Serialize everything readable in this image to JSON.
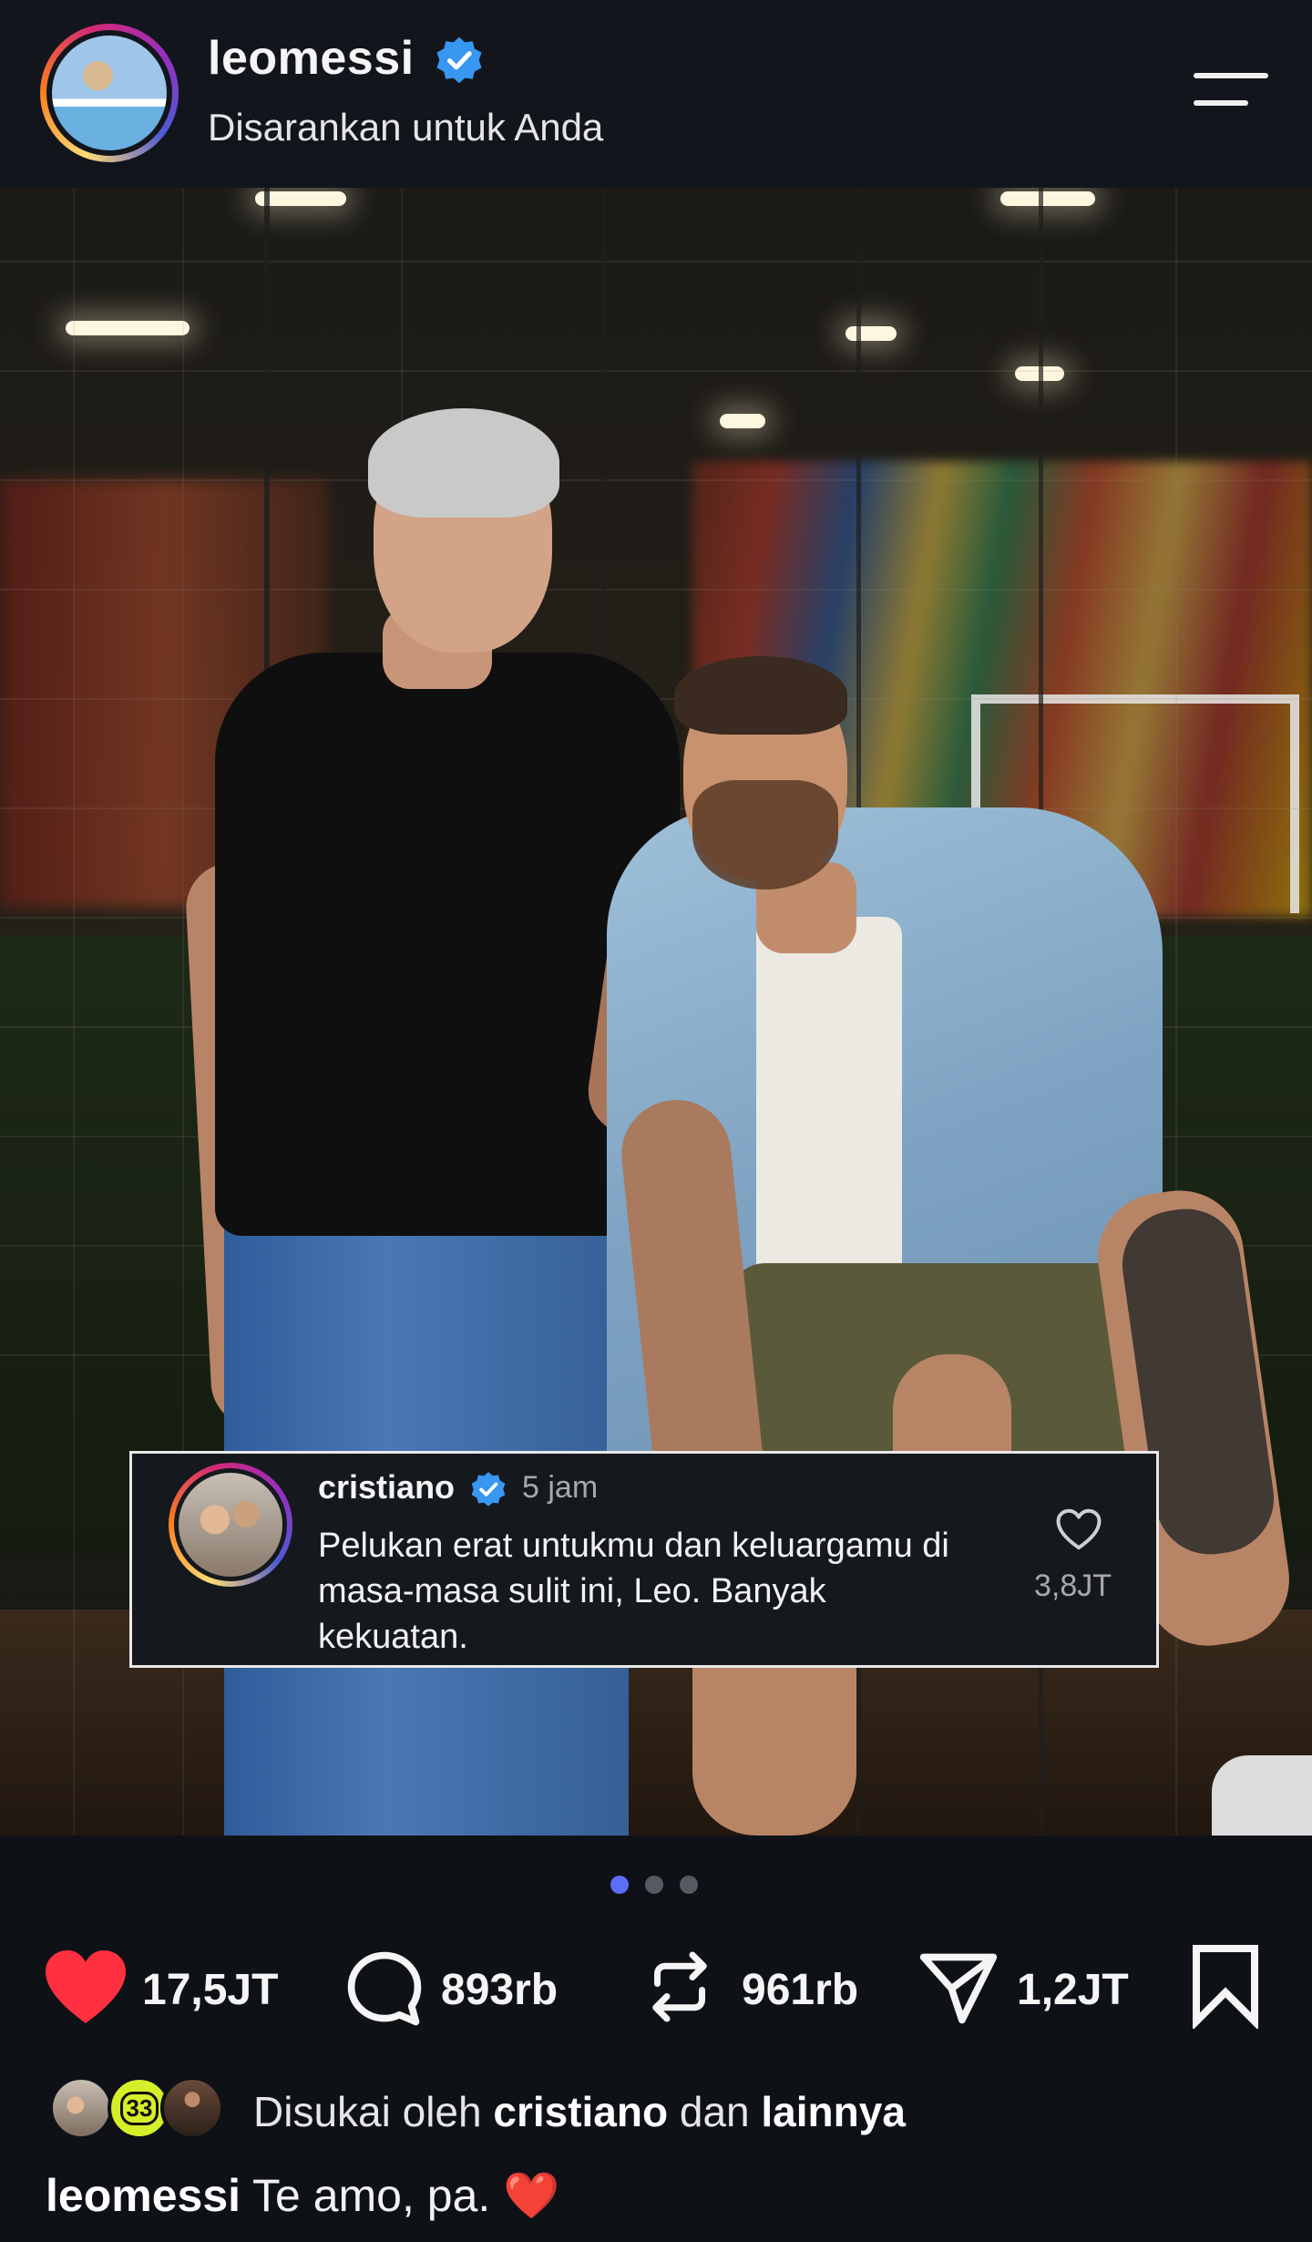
{
  "header": {
    "username": "leomessi",
    "subtitle": "Disarankan untuk Anda"
  },
  "post": {
    "carousel": {
      "total": 3,
      "active_index": 0,
      "active_color": "#5b6ef5",
      "inactive_color": "#555a62"
    }
  },
  "top_comment": {
    "username": "cristiano",
    "time": "5 jam",
    "text": "Pelukan erat untukmu dan keluargamu di masa-masa sulit ini, Leo. Banyak kekuatan.",
    "likes": "3,8JT"
  },
  "actions": {
    "likes": "17,5JT",
    "comments": "893rb",
    "reposts": "961rb",
    "shares": "1,2JT",
    "like_color": "#ff3040"
  },
  "liked_by": {
    "prefix": "Disukai oleh",
    "user": "cristiano",
    "connector": "dan",
    "others": "lainnya",
    "badge_text": "33"
  },
  "caption": {
    "username": "leomessi",
    "text": "Te amo, pa.",
    "emoji": "❤️"
  },
  "colors": {
    "background": "#0e1116",
    "verified": "#3897f0"
  }
}
